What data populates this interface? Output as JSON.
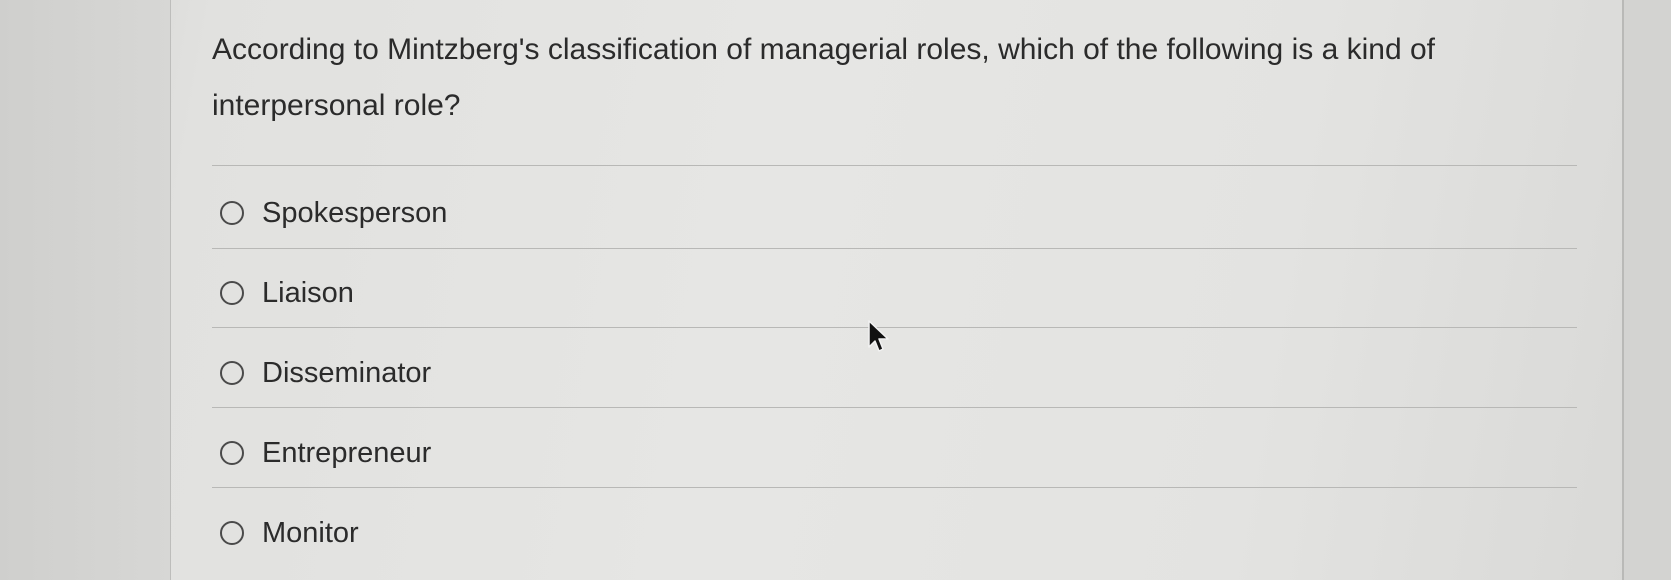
{
  "question": {
    "text": "According to Mintzberg's classification of managerial roles, which of the following is a kind of interpersonal role?"
  },
  "options": [
    {
      "label": "Spokesperson",
      "selected": false
    },
    {
      "label": "Liaison",
      "selected": false
    },
    {
      "label": "Disseminator",
      "selected": false
    },
    {
      "label": "Entrepreneur",
      "selected": false
    },
    {
      "label": "Monitor",
      "selected": false
    }
  ],
  "icons": {
    "radio": "radio-unchecked-icon",
    "cursor": "mouse-pointer-icon"
  },
  "colors": {
    "text": "#2b2b2b",
    "background": "#e4e4e2",
    "divider": "#b8b8b6"
  }
}
